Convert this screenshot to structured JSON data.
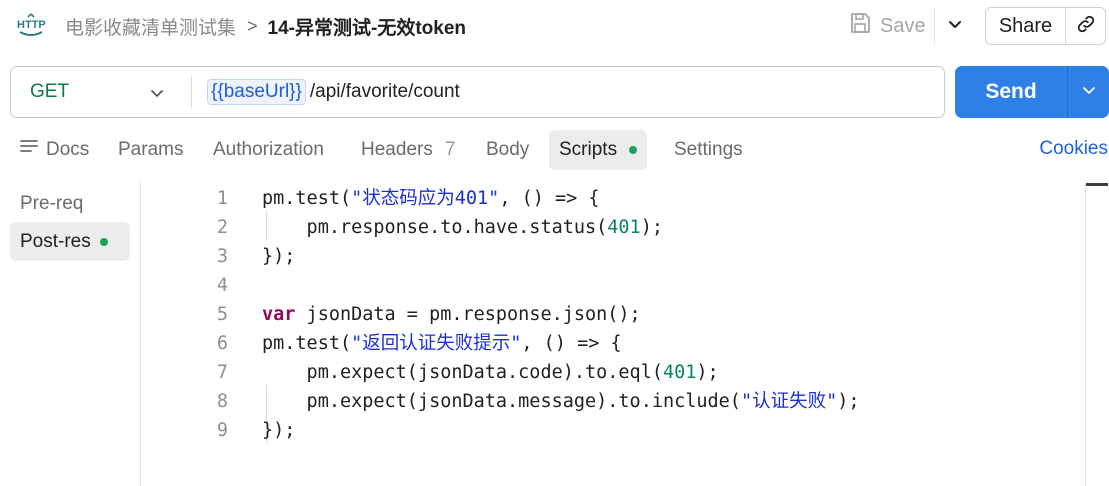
{
  "header": {
    "http_icon_text": "HTTP",
    "breadcrumb_parent": "电影收藏清单测试集",
    "breadcrumb_separator": ">",
    "request_name": "14-异常测试-无效token",
    "save_label": "Save",
    "share_label": "Share"
  },
  "request": {
    "method": "GET",
    "url_variable": "{{baseUrl}}",
    "url_path": "/api/favorite/count",
    "send_label": "Send"
  },
  "tabs": {
    "docs": "Docs",
    "params": "Params",
    "authorization": "Authorization",
    "headers": "Headers",
    "headers_count": "7",
    "body": "Body",
    "scripts": "Scripts",
    "settings": "Settings",
    "cookies": "Cookies",
    "active": "Scripts"
  },
  "script_nav": {
    "pre_request": "Pre-req",
    "post_response": "Post-res",
    "active": "Post-res"
  },
  "editor": {
    "line_numbers": [
      "1",
      "2",
      "3",
      "4",
      "5",
      "6",
      "7",
      "8",
      "9"
    ],
    "lines": [
      [
        {
          "t": "pm.test("
        },
        {
          "t": "\"状态码应为401\"",
          "c": "str"
        },
        {
          "t": ", () => {"
        }
      ],
      [
        {
          "t": "    pm.response.to.have.status("
        },
        {
          "t": "401",
          "c": "num"
        },
        {
          "t": ");"
        }
      ],
      [
        {
          "t": "});"
        }
      ],
      [],
      [
        {
          "t": "var",
          "c": "kw"
        },
        {
          "t": " jsonData = pm.response.json();"
        }
      ],
      [
        {
          "t": "pm.test("
        },
        {
          "t": "\"返回认证失败提示\"",
          "c": "str"
        },
        {
          "t": ", () => {"
        }
      ],
      [
        {
          "t": "    pm.expect(jsonData.code).to.eql("
        },
        {
          "t": "401",
          "c": "num"
        },
        {
          "t": ");"
        }
      ],
      [
        {
          "t": "    pm.expect(jsonData.message).to.include("
        },
        {
          "t": "\"认证失败\"",
          "c": "str"
        },
        {
          "t": ");"
        }
      ],
      [
        {
          "t": "});"
        }
      ]
    ]
  },
  "colors": {
    "accent": "#2f80e6",
    "method_get": "#0c7a43",
    "status_dot": "#1aa35b",
    "link": "#1e64d8"
  }
}
